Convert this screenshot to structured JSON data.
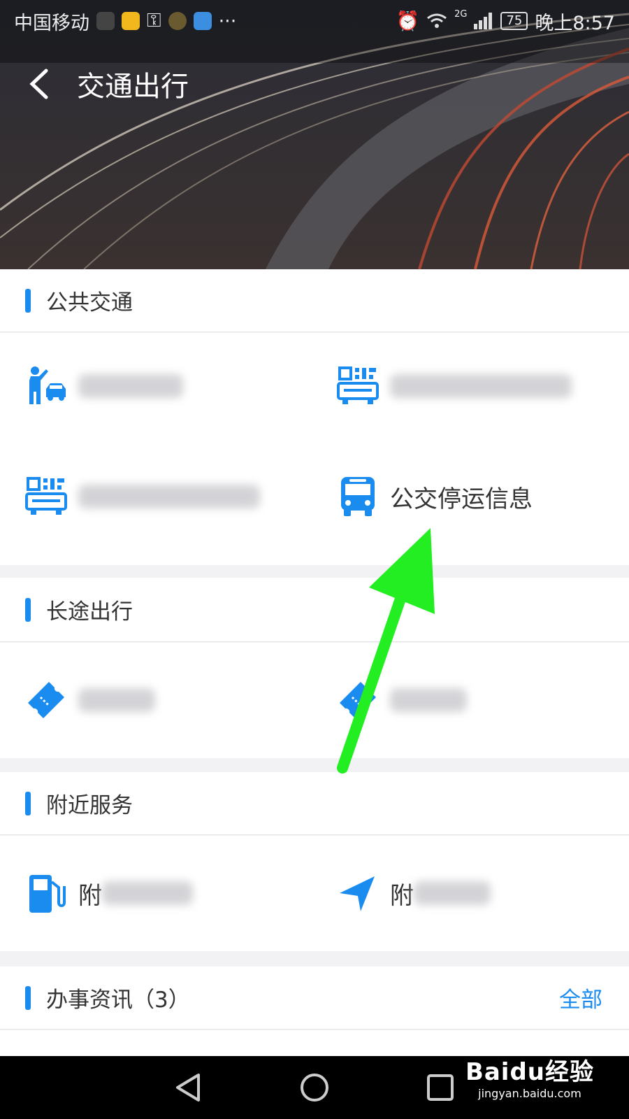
{
  "status_bar": {
    "carrier": "中国移动",
    "signal_label": "2G",
    "battery": "75",
    "time": "晚上8:57",
    "more": "···"
  },
  "header": {
    "title": "交通出行"
  },
  "sections": {
    "public_transport": {
      "title": "公共交通",
      "items": {
        "taxi": "",
        "bus_card_a": "",
        "bus_card_b": "",
        "bus_suspension": "公交停运信息"
      }
    },
    "long_distance": {
      "title": "长途出行",
      "items": {
        "train": "",
        "coach": ""
      }
    },
    "nearby": {
      "title": "附近服务",
      "items": {
        "gas_prefix": "附",
        "bank_prefix": "附"
      }
    },
    "news": {
      "title": "办事资讯（3）",
      "more": "全部"
    }
  },
  "watermark": {
    "main": "Baidu经验",
    "sub": "jingyan.baidu.com"
  },
  "colors": {
    "accent": "#1a8cf0",
    "annotation_arrow": "#22ee22"
  }
}
